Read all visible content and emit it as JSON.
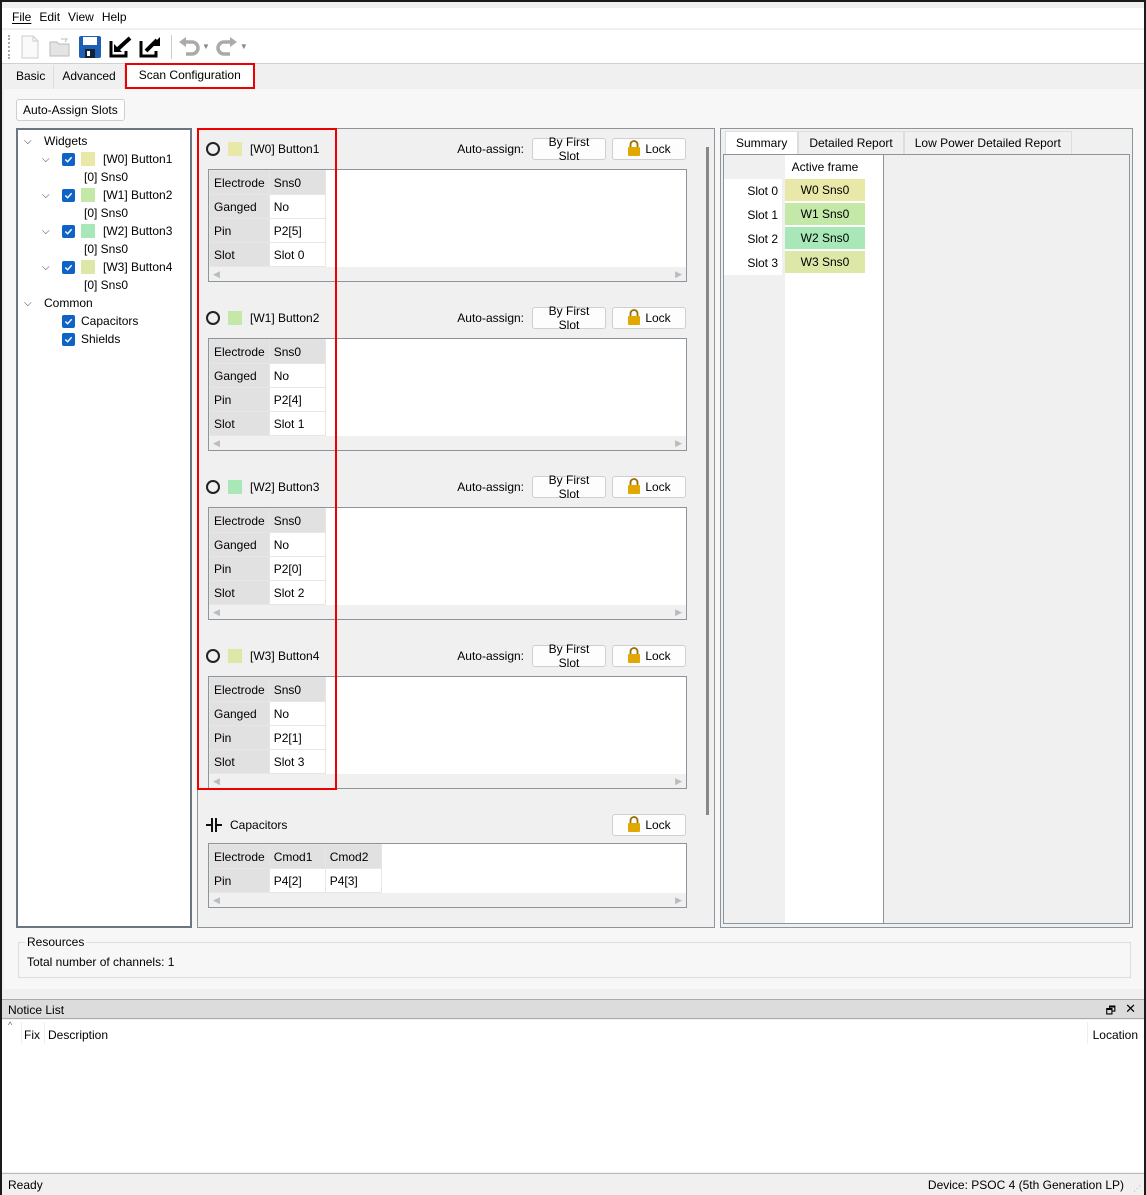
{
  "menu": [
    "File",
    "Edit",
    "View",
    "Help"
  ],
  "toolbar": {
    "icons": [
      "new-file-icon",
      "open-folder-icon",
      "save-icon",
      "import-icon",
      "export-icon",
      "undo-icon",
      "redo-icon"
    ]
  },
  "tabs": [
    {
      "label": "Basic",
      "active": false
    },
    {
      "label": "Advanced",
      "active": false
    },
    {
      "label": "Scan Configuration",
      "active": true
    }
  ],
  "auto_assign_slots_label": "Auto-Assign Slots",
  "tree": {
    "widgets_label": "Widgets",
    "widgets": [
      {
        "label": "[W0] Button1",
        "sensor": "[0] Sns0",
        "color": "#e8e8a8",
        "checked": true
      },
      {
        "label": "[W1] Button2",
        "sensor": "[0] Sns0",
        "color": "#c3e8a8",
        "checked": true
      },
      {
        "label": "[W2] Button3",
        "sensor": "[0] Sns0",
        "color": "#a8e8b8",
        "checked": true
      },
      {
        "label": "[W3] Button4",
        "sensor": "[0] Sns0",
        "color": "#dde8a8",
        "checked": true
      }
    ],
    "common_label": "Common",
    "common": [
      {
        "label": "Capacitors",
        "checked": true
      },
      {
        "label": "Shields",
        "checked": true
      }
    ]
  },
  "widget_panels": [
    {
      "name": "[W0] Button1",
      "color": "#e8e8a8",
      "auto_assign_label": "Auto-assign:",
      "first_slot_label": "By First Slot",
      "lock_label": "Lock",
      "rows": [
        [
          "Electrode",
          "Sns0"
        ],
        [
          "Ganged",
          "No"
        ],
        [
          "Pin",
          "P2[5]"
        ],
        [
          "Slot",
          "Slot 0"
        ]
      ]
    },
    {
      "name": "[W1] Button2",
      "color": "#c3e8a8",
      "auto_assign_label": "Auto-assign:",
      "first_slot_label": "By First Slot",
      "lock_label": "Lock",
      "rows": [
        [
          "Electrode",
          "Sns0"
        ],
        [
          "Ganged",
          "No"
        ],
        [
          "Pin",
          "P2[4]"
        ],
        [
          "Slot",
          "Slot 1"
        ]
      ]
    },
    {
      "name": "[W2] Button3",
      "color": "#a8e8b8",
      "auto_assign_label": "Auto-assign:",
      "first_slot_label": "By First Slot",
      "lock_label": "Lock",
      "rows": [
        [
          "Electrode",
          "Sns0"
        ],
        [
          "Ganged",
          "No"
        ],
        [
          "Pin",
          "P2[0]"
        ],
        [
          "Slot",
          "Slot 2"
        ]
      ]
    },
    {
      "name": "[W3] Button4",
      "color": "#dde8a8",
      "auto_assign_label": "Auto-assign:",
      "first_slot_label": "By First Slot",
      "lock_label": "Lock",
      "rows": [
        [
          "Electrode",
          "Sns0"
        ],
        [
          "Ganged",
          "No"
        ],
        [
          "Pin",
          "P2[1]"
        ],
        [
          "Slot",
          "Slot 3"
        ]
      ]
    }
  ],
  "capacitors": {
    "title": "Capacitors",
    "lock_label": "Lock",
    "rows": [
      [
        "Electrode",
        "Cmod1",
        "Cmod2"
      ],
      [
        "Pin",
        "P4[2]",
        "P4[3]"
      ]
    ]
  },
  "report": {
    "tabs": [
      {
        "label": "Summary",
        "active": true
      },
      {
        "label": "Detailed Report",
        "active": false
      },
      {
        "label": "Low Power Detailed Report",
        "active": false
      }
    ],
    "column_header": "Active frame",
    "slots": [
      {
        "slot": "Slot 0",
        "value": "W0 Sns0",
        "color": "#e8e8a8"
      },
      {
        "slot": "Slot 1",
        "value": "W1 Sns0",
        "color": "#c3e8a8"
      },
      {
        "slot": "Slot 2",
        "value": "W2 Sns0",
        "color": "#a8e8b8"
      },
      {
        "slot": "Slot 3",
        "value": "W3 Sns0",
        "color": "#dde8a8"
      }
    ]
  },
  "resources": {
    "title": "Resources",
    "text": "Total number of channels: 1"
  },
  "notice": {
    "title": "Notice List",
    "col_fix": "Fix",
    "col_description": "Description",
    "col_location": "Location"
  },
  "status": {
    "left": "Ready",
    "right": "Device: PSOC 4 (5th Generation LP)"
  },
  "highlight_color": "#e00000"
}
